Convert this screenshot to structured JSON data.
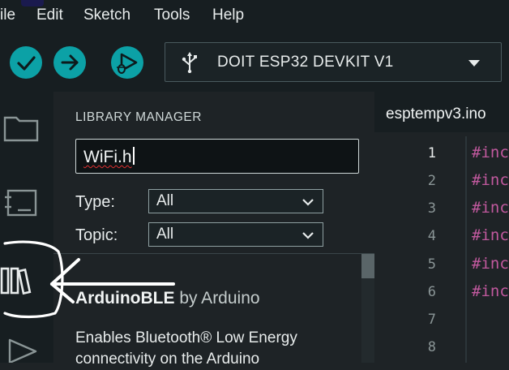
{
  "menu": {
    "items": [
      "ile",
      "Edit",
      "Sketch",
      "Tools",
      "Help"
    ]
  },
  "toolbar": {
    "verify_icon": "checkmark-icon",
    "upload_icon": "arrow-right-icon",
    "debug_icon": "debug-play-icon",
    "board": "DOIT ESP32 DEVKIT V1",
    "usb_icon": "usb-icon"
  },
  "library_manager": {
    "title": "LIBRARY MANAGER",
    "search_value": "WiFi.h",
    "type_label": "Type:",
    "type_value": "All",
    "topic_label": "Topic:",
    "topic_value": "All",
    "result": {
      "name": "ArduinoBLE",
      "by": "by Arduino",
      "description": "Enables Bluetooth® Low Energy connectivity on the Arduino"
    }
  },
  "editor": {
    "tab": "esptempv3.ino",
    "lines": [
      {
        "num": "1",
        "code": "#inc"
      },
      {
        "num": "2",
        "code": "#inc"
      },
      {
        "num": "3",
        "code": "#inc"
      },
      {
        "num": "4",
        "code": "#inc"
      },
      {
        "num": "5",
        "code": "#inc"
      },
      {
        "num": "6",
        "code": "#inc"
      },
      {
        "num": "7",
        "code": ""
      },
      {
        "num": "8",
        "code": ""
      }
    ]
  },
  "colors": {
    "accent": "#0ca1a6",
    "background": "#1e2326",
    "keyword": "#c1599e"
  }
}
